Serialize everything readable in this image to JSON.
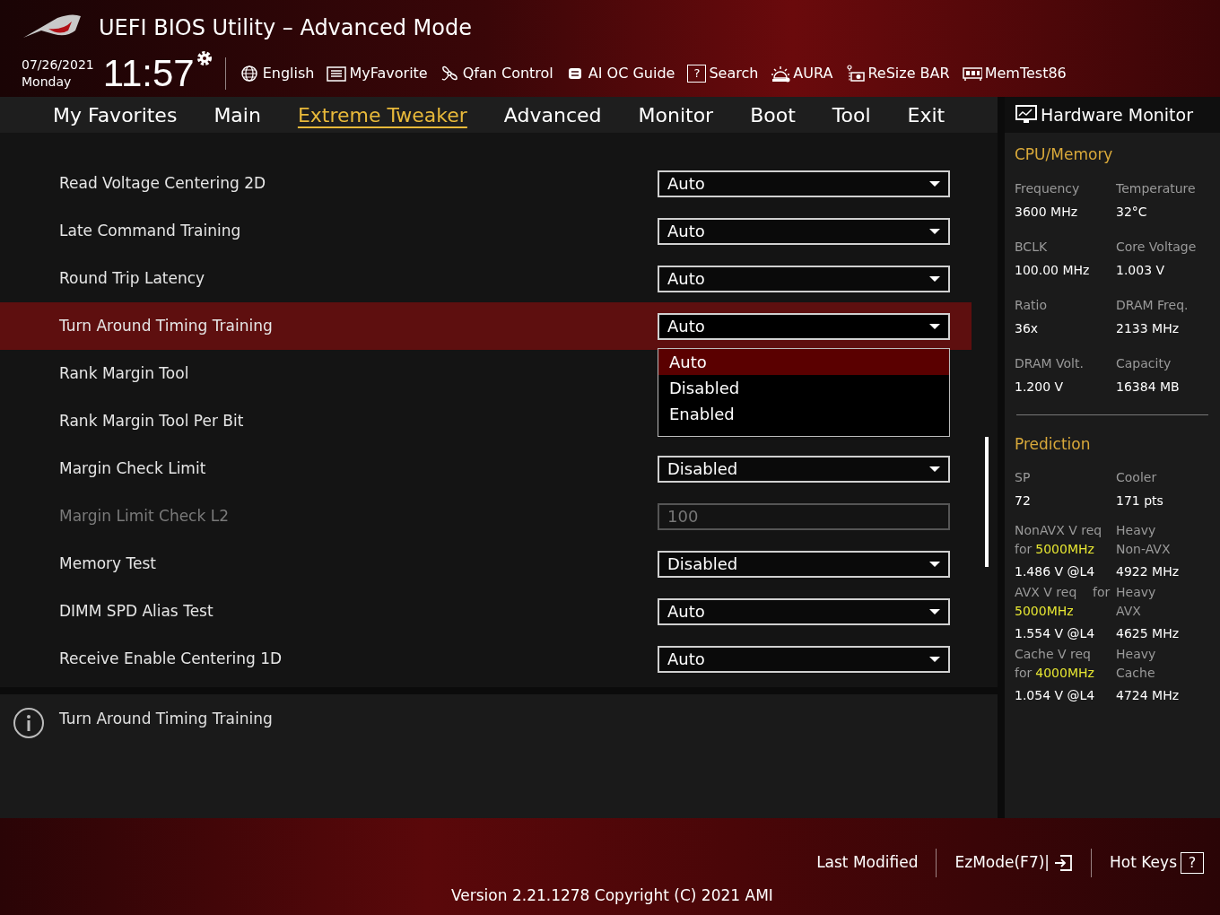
{
  "header": {
    "title": "UEFI BIOS Utility – Advanced Mode",
    "date": "07/26/2021",
    "day": "Monday",
    "time": "11:57"
  },
  "toolbar": [
    {
      "label": "English"
    },
    {
      "label": "MyFavorite"
    },
    {
      "label": "Qfan Control"
    },
    {
      "label": "AI OC Guide"
    },
    {
      "label": "Search",
      "glyph": "?"
    },
    {
      "label": "AURA"
    },
    {
      "label": "ReSize BAR"
    },
    {
      "label": "MemTest86"
    }
  ],
  "tabs": [
    {
      "label": "My Favorites",
      "selected": false
    },
    {
      "label": "Main",
      "selected": false
    },
    {
      "label": "Extreme Tweaker",
      "selected": true
    },
    {
      "label": "Advanced",
      "selected": false
    },
    {
      "label": "Monitor",
      "selected": false
    },
    {
      "label": "Boot",
      "selected": false
    },
    {
      "label": "Tool",
      "selected": false
    },
    {
      "label": "Exit",
      "selected": false
    }
  ],
  "settings": [
    {
      "label": "Read Voltage Centering 2D",
      "value": "Auto",
      "kind": "dropdown",
      "selected": false,
      "disabled": false
    },
    {
      "label": "Late Command Training",
      "value": "Auto",
      "kind": "dropdown",
      "selected": false,
      "disabled": false
    },
    {
      "label": "Round Trip Latency",
      "value": "Auto",
      "kind": "dropdown",
      "selected": false,
      "disabled": false
    },
    {
      "label": "Turn Around Timing Training",
      "value": "Auto",
      "kind": "dropdown",
      "selected": true,
      "disabled": false,
      "expanded": true,
      "options": [
        {
          "label": "Auto",
          "selected": true
        },
        {
          "label": "Disabled",
          "selected": false
        },
        {
          "label": "Enabled",
          "selected": false
        }
      ]
    },
    {
      "label": "Rank Margin Tool",
      "kind": "hidden",
      "selected": false,
      "disabled": false
    },
    {
      "label": "Rank Margin Tool Per Bit",
      "kind": "hidden",
      "selected": false,
      "disabled": false
    },
    {
      "label": "Margin Check Limit",
      "value": "Disabled",
      "kind": "dropdown",
      "selected": false,
      "disabled": false
    },
    {
      "label": "Margin Limit Check L2",
      "value": "100",
      "kind": "input",
      "selected": false,
      "disabled": true
    },
    {
      "label": "Memory Test",
      "value": "Disabled",
      "kind": "dropdown",
      "selected": false,
      "disabled": false
    },
    {
      "label": "DIMM SPD Alias Test",
      "value": "Auto",
      "kind": "dropdown",
      "selected": false,
      "disabled": false
    },
    {
      "label": "Receive Enable Centering 1D",
      "value": "Auto",
      "kind": "dropdown",
      "selected": false,
      "disabled": false
    }
  ],
  "help_text": "Turn Around Timing Training",
  "hardware_monitor": {
    "title": "Hardware Monitor",
    "cpu_memory": {
      "title": "CPU/Memory",
      "items": [
        {
          "label": "Frequency",
          "value": "3600 MHz"
        },
        {
          "label": "Temperature",
          "value": "32°C"
        },
        {
          "label": "BCLK",
          "value": "100.00 MHz"
        },
        {
          "label": "Core Voltage",
          "value": "1.003 V"
        },
        {
          "label": "Ratio",
          "value": "36x"
        },
        {
          "label": "DRAM Freq.",
          "value": "2133 MHz"
        },
        {
          "label": "DRAM Volt.",
          "value": "1.200 V"
        },
        {
          "label": "Capacity",
          "value": "16384 MB"
        }
      ]
    },
    "prediction": {
      "title": "Prediction",
      "sp": {
        "label": "SP",
        "value": "72"
      },
      "cooler": {
        "label": "Cooler",
        "value": "171 pts"
      },
      "rows": [
        {
          "label": "NonAVX V req",
          "prefix": "for",
          "highlight": "5000MHz",
          "value": "1.486 V @L4",
          "right_label": "Heavy Non-AVX",
          "right_value": "4922 MHz"
        },
        {
          "label": "AVX V req    for",
          "highlight": "5000MHz",
          "value": "1.554 V @L4",
          "right_label": "Heavy AVX",
          "right_value": "4625 MHz"
        },
        {
          "label": "Cache V req",
          "prefix": "for",
          "highlight": "4000MHz",
          "value": "1.054 V @L4",
          "right_label": "Heavy Cache",
          "right_value": "4724 MHz"
        }
      ]
    }
  },
  "footer": {
    "buttons": [
      {
        "label": "Last Modified"
      },
      {
        "label": "EzMode(F7)|"
      },
      {
        "label": "Hot Keys",
        "glyph": "?"
      }
    ],
    "version": "Version 2.21.1278 Copyright (C) 2021 AMI"
  }
}
